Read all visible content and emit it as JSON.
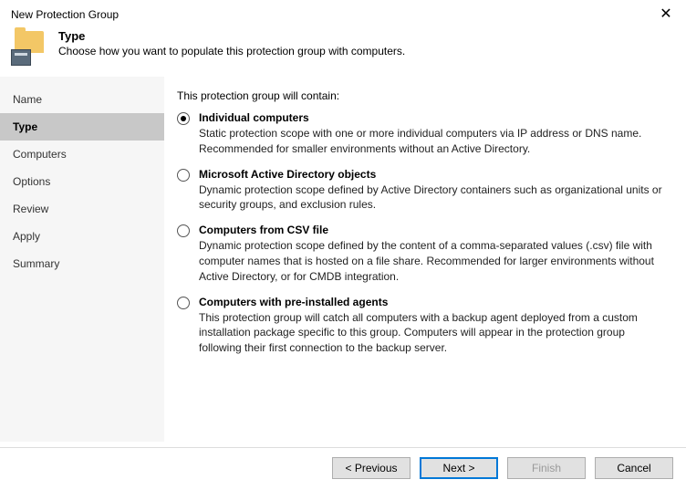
{
  "window": {
    "title": "New Protection Group",
    "close_glyph": "✕"
  },
  "header": {
    "title": "Type",
    "subtitle": "Choose how you want to populate this protection group with computers."
  },
  "sidebar": {
    "items": [
      {
        "label": "Name",
        "active": false
      },
      {
        "label": "Type",
        "active": true
      },
      {
        "label": "Computers",
        "active": false
      },
      {
        "label": "Options",
        "active": false
      },
      {
        "label": "Review",
        "active": false
      },
      {
        "label": "Apply",
        "active": false
      },
      {
        "label": "Summary",
        "active": false
      }
    ]
  },
  "content": {
    "intro": "This protection group will contain:",
    "options": [
      {
        "selected": true,
        "title": "Individual computers",
        "desc": "Static protection scope with one or more individual computers via IP address or DNS name. Recommended for smaller environments without an Active Directory."
      },
      {
        "selected": false,
        "title": "Microsoft Active Directory objects",
        "desc": "Dynamic protection scope defined by Active Directory containers such as organizational units or security groups, and exclusion rules."
      },
      {
        "selected": false,
        "title": "Computers from CSV file",
        "desc": "Dynamic protection scope defined by the content of a comma-separated values (.csv) file with computer names that is hosted on a file share. Recommended for larger environments without Active Directory, or for CMDB integration."
      },
      {
        "selected": false,
        "title": "Computers with pre-installed agents",
        "desc": "This protection group will catch all computers with a backup agent deployed from a custom installation package specific to this group.  Computers will appear in the protection group following their first connection to the backup server."
      }
    ]
  },
  "footer": {
    "previous": "< Previous",
    "next": "Next >",
    "finish": "Finish",
    "cancel": "Cancel"
  }
}
